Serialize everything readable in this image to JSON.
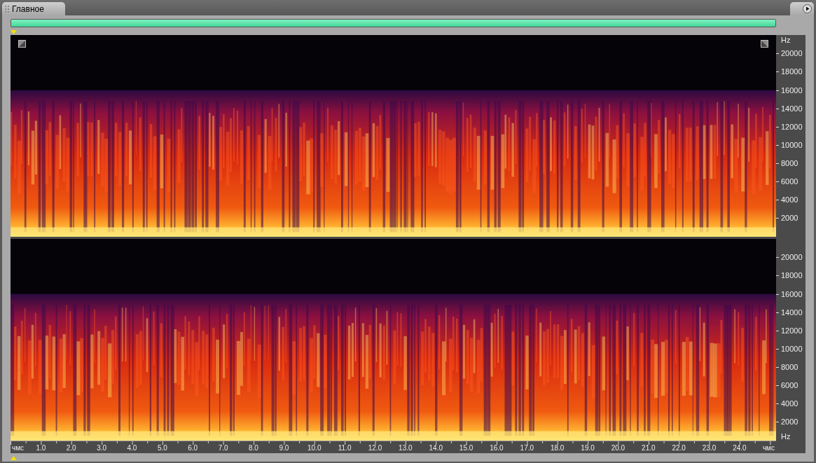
{
  "tab": {
    "title": "Главное"
  },
  "channels": [
    {
      "unit_top": "Hz",
      "freq_labels": [
        "20000",
        "18000",
        "16000",
        "14000",
        "12000",
        "10000",
        "8000",
        "6000",
        "4000",
        "2000"
      ]
    },
    {
      "unit_bottom": "Hz",
      "freq_labels": [
        "20000",
        "18000",
        "16000",
        "14000",
        "12000",
        "10000",
        "8000",
        "6000",
        "4000",
        "2000"
      ]
    }
  ],
  "time_axis": {
    "unit_start": "чмс",
    "unit_end": "чмс",
    "labels": [
      "1.0",
      "2.0",
      "3.0",
      "4.0",
      "5.0",
      "6.0",
      "7.0",
      "8.0",
      "9.0",
      "10.0",
      "11.0",
      "12.0",
      "13.0",
      "14.0",
      "15.0",
      "16.0",
      "17.0",
      "18.0",
      "19.0",
      "20.0",
      "21.0",
      "22.0",
      "23.0",
      "24.0"
    ]
  }
}
